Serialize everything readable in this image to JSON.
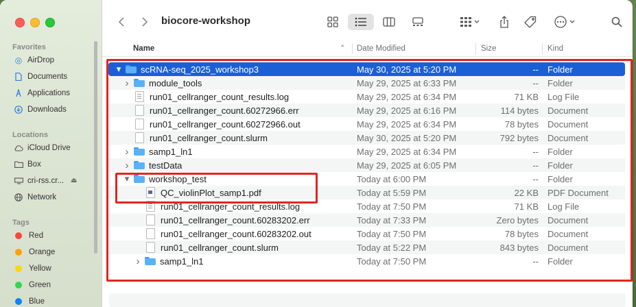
{
  "window": {
    "title": "biocore-workshop"
  },
  "colors": {
    "selection": "#1b5fd6",
    "folder": "#5ab2f6",
    "highlight_box": "#e0261f"
  },
  "sidebar": {
    "favorites_label": "Favorites",
    "favorites": [
      {
        "label": "AirDrop",
        "icon": "airdrop-icon"
      },
      {
        "label": "Documents",
        "icon": "document-icon"
      },
      {
        "label": "Applications",
        "icon": "applications-icon"
      },
      {
        "label": "Downloads",
        "icon": "download-icon"
      }
    ],
    "locations_label": "Locations",
    "locations": [
      {
        "label": "iCloud Drive",
        "icon": "cloud-icon"
      },
      {
        "label": "Box",
        "icon": "folder-icon"
      },
      {
        "label": "cri-rss.cr...",
        "icon": "server-icon"
      },
      {
        "label": "Network",
        "icon": "network-icon"
      }
    ],
    "tags_label": "Tags",
    "tags": [
      {
        "label": "Red",
        "color": "#ff453a"
      },
      {
        "label": "Orange",
        "color": "#ff9f0a"
      },
      {
        "label": "Yellow",
        "color": "#ffd60a"
      },
      {
        "label": "Green",
        "color": "#32d74b"
      },
      {
        "label": "Blue",
        "color": "#0a84ff"
      }
    ]
  },
  "columns": {
    "name": "Name",
    "date": "Date Modified",
    "size": "Size",
    "kind": "Kind"
  },
  "rows": [
    {
      "name": "scRNA-seq_2025_workshop3",
      "date": "May 30, 2025 at 5:20 PM",
      "size": "--",
      "kind": "Folder",
      "type": "folder",
      "expanded": true,
      "level": 0,
      "selected": true
    },
    {
      "name": "module_tools",
      "date": "May 29, 2025 at 6:33 PM",
      "size": "--",
      "kind": "Folder",
      "type": "folder",
      "expanded": false,
      "level": 1
    },
    {
      "name": "run01_cellranger_count_results.log",
      "date": "May 29, 2025 at 6:34 PM",
      "size": "71 KB",
      "kind": "Log File",
      "type": "log",
      "level": 1
    },
    {
      "name": "run01_cellranger_count.60272966.err",
      "date": "May 29, 2025 at 6:16 PM",
      "size": "114 bytes",
      "kind": "Document",
      "type": "doc",
      "level": 1
    },
    {
      "name": "run01_cellranger_count.60272966.out",
      "date": "May 29, 2025 at 6:34 PM",
      "size": "78 bytes",
      "kind": "Document",
      "type": "doc",
      "level": 1
    },
    {
      "name": "run01_cellranger_count.slurm",
      "date": "May 30, 2025 at 5:20 PM",
      "size": "792 bytes",
      "kind": "Document",
      "type": "doc",
      "level": 1
    },
    {
      "name": "samp1_ln1",
      "date": "May 29, 2025 at 6:34 PM",
      "size": "--",
      "kind": "Folder",
      "type": "folder",
      "expanded": false,
      "level": 1
    },
    {
      "name": "testData",
      "date": "May 29, 2025 at 6:05 PM",
      "size": "--",
      "kind": "Folder",
      "type": "folder",
      "expanded": false,
      "level": 1
    },
    {
      "name": "workshop_test",
      "date": "Today at 6:00 PM",
      "size": "--",
      "kind": "Folder",
      "type": "folder",
      "expanded": true,
      "level": 1
    },
    {
      "name": "QC_violinPlot_samp1.pdf",
      "date": "Today at 5:59 PM",
      "size": "22 KB",
      "kind": "PDF Document",
      "type": "pdf",
      "level": 2
    },
    {
      "name": "run01_cellranger_count_results.log",
      "date": "Today at 7:50 PM",
      "size": "71 KB",
      "kind": "Log File",
      "type": "log",
      "level": 2
    },
    {
      "name": "run01_cellranger_count.60283202.err",
      "date": "Today at 7:33 PM",
      "size": "Zero bytes",
      "kind": "Document",
      "type": "doc",
      "level": 2
    },
    {
      "name": "run01_cellranger_count.60283202.out",
      "date": "Today at 7:50 PM",
      "size": "78 bytes",
      "kind": "Document",
      "type": "doc",
      "level": 2
    },
    {
      "name": "run01_cellranger_count.slurm",
      "date": "Today at 5:22 PM",
      "size": "843 bytes",
      "kind": "Document",
      "type": "doc",
      "level": 2
    },
    {
      "name": "samp1_ln1",
      "date": "Today at 7:50 PM",
      "size": "--",
      "kind": "Folder",
      "type": "folder",
      "expanded": false,
      "level": 2
    }
  ]
}
